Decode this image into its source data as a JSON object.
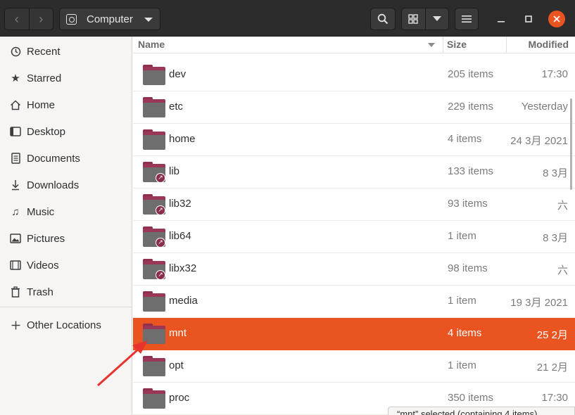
{
  "header": {
    "back_icon": "chevron-left-icon",
    "forward_icon": "chevron-right-icon",
    "location_label": "Computer",
    "location_icon": "drive-icon"
  },
  "sidebar": {
    "items": [
      {
        "label": "Recent",
        "icon": "clock-icon"
      },
      {
        "label": "Starred",
        "icon": "star-icon"
      },
      {
        "label": "Home",
        "icon": "home-icon"
      },
      {
        "label": "Desktop",
        "icon": "desktop-icon"
      },
      {
        "label": "Documents",
        "icon": "document-icon"
      },
      {
        "label": "Downloads",
        "icon": "download-icon"
      },
      {
        "label": "Music",
        "icon": "music-icon"
      },
      {
        "label": "Pictures",
        "icon": "picture-icon"
      },
      {
        "label": "Videos",
        "icon": "video-icon"
      },
      {
        "label": "Trash",
        "icon": "trash-icon"
      }
    ],
    "other_locations": "Other Locations"
  },
  "columns": {
    "name": "Name",
    "size": "Size",
    "modified": "Modified"
  },
  "rows": [
    {
      "name": "dev",
      "size": "205 items",
      "modified": "17:30",
      "symlink": false
    },
    {
      "name": "etc",
      "size": "229 items",
      "modified": "Yesterday",
      "symlink": false
    },
    {
      "name": "home",
      "size": "4 items",
      "modified": "24 3月 2021",
      "symlink": false
    },
    {
      "name": "lib",
      "size": "133 items",
      "modified": "8 3月",
      "symlink": true
    },
    {
      "name": "lib32",
      "size": "93 items",
      "modified": "六",
      "symlink": true
    },
    {
      "name": "lib64",
      "size": "1 item",
      "modified": "8 3月",
      "symlink": true
    },
    {
      "name": "libx32",
      "size": "98 items",
      "modified": "六",
      "symlink": true
    },
    {
      "name": "media",
      "size": "1 item",
      "modified": "19 3月 2021",
      "symlink": false
    },
    {
      "name": "mnt",
      "size": "4 items",
      "modified": "25 2月",
      "symlink": false,
      "selected": true
    },
    {
      "name": "opt",
      "size": "1 item",
      "modified": "21 2月",
      "symlink": false
    },
    {
      "name": "proc",
      "size": "350 items",
      "modified": "17:30",
      "symlink": false
    }
  ],
  "status": "“mnt” selected  (containing 4 items)",
  "colors": {
    "accent": "#e95420",
    "headerbar": "#2c2c2c",
    "annotation": "#e8322d"
  }
}
